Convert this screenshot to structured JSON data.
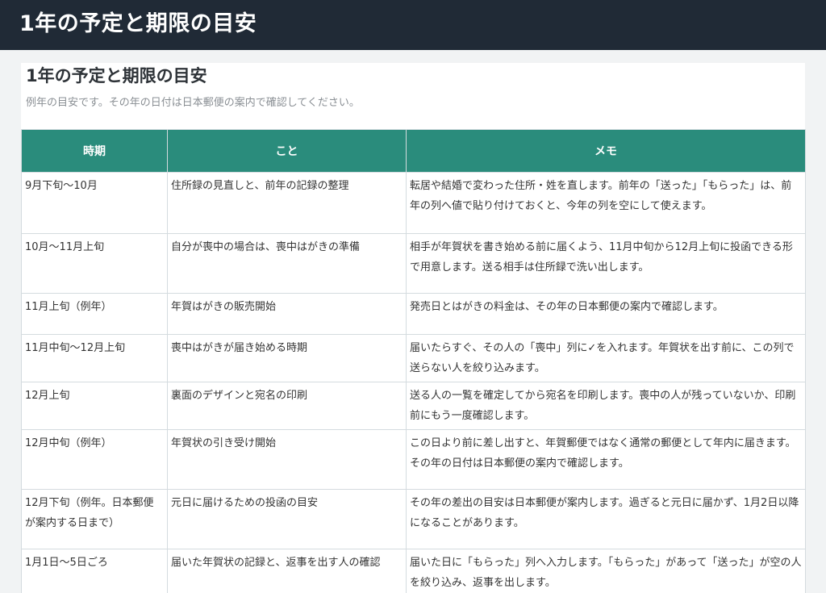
{
  "header": {
    "title": "1年の予定と期限の目安"
  },
  "document": {
    "title": "1年の予定と期限の目安",
    "subtitle": "例年の目安です。その年の日付は日本郵便の案内で確認してください。"
  },
  "table": {
    "headers": [
      "時期",
      "こと",
      "メモ"
    ],
    "rows": [
      {
        "period": "9月下旬〜10月",
        "task": "住所録の見直しと、前年の記録の整理",
        "memo": "転居や結婚で変わった住所・姓を直します。前年の「送った」「もらった」は、前年の列へ値で貼り付けておくと、今年の列を空にして使えます。"
      },
      {
        "period": "10月〜11月上旬",
        "task": "自分が喪中の場合は、喪中はがきの準備",
        "memo": "相手が年賀状を書き始める前に届くよう、11月中旬から12月上旬に投函できる形で用意します。送る相手は住所録で洗い出します。"
      },
      {
        "period": "11月上旬（例年）",
        "task": "年賀はがきの販売開始",
        "memo": "発売日とはがきの料金は、その年の日本郵便の案内で確認します。"
      },
      {
        "period": "11月中旬〜12月上旬",
        "task": "喪中はがきが届き始める時期",
        "memo": "届いたらすぐ、その人の「喪中」列に✓を入れます。年賀状を出す前に、この列で送らない人を絞り込みます。"
      },
      {
        "period": "12月上旬",
        "task": "裏面のデザインと宛名の印刷",
        "memo": "送る人の一覧を確定してから宛名を印刷します。喪中の人が残っていないか、印刷前にもう一度確認します。"
      },
      {
        "period": "12月中旬（例年）",
        "task": "年賀状の引き受け開始",
        "memo": "この日より前に差し出すと、年賀郵便ではなく通常の郵便として年内に届きます。その年の日付は日本郵便の案内で確認します。"
      },
      {
        "period": "12月下旬（例年。日本郵便が案内する日まで）",
        "task": "元日に届けるための投函の目安",
        "memo": "その年の差出の目安は日本郵便が案内します。過ぎると元日に届かず、1月2日以降になることがあります。"
      },
      {
        "period": "1月1日〜5日ごろ",
        "task": "届いた年賀状の記録と、返事を出す人の確認",
        "memo": "届いた日に「もらった」列へ入力します。「もらった」があって「送った」が空の人を絞り込み、返事を出します。"
      }
    ]
  }
}
